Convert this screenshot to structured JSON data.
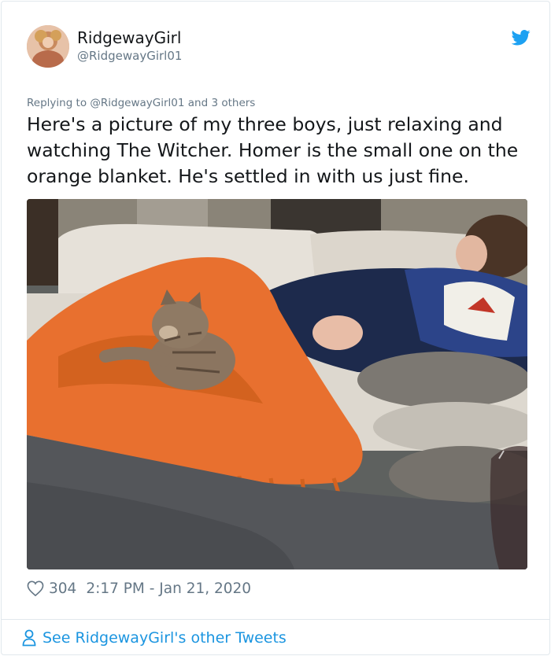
{
  "user": {
    "display_name": "RidgewayGirl",
    "handle": "@RidgewayGirl01"
  },
  "tweet": {
    "replying_to": "Replying to @RidgewayGirl01 and 3 others",
    "text": "Here's a picture of my three boys, just relaxing and watching The Witcher. Homer is the small one on the orange blanket. He's settled in with us just fine.",
    "likes": "304",
    "timestamp": "2:17 PM - Jan 21, 2020"
  },
  "footer": {
    "see_more": "See RidgewayGirl's other Tweets"
  },
  "colors": {
    "twitter_blue": "#1da1f2",
    "link_blue": "#1b95e0",
    "muted_gray": "#657786",
    "blanket_orange": "#e8702f"
  },
  "icons": [
    "twitter-bird-icon",
    "heart-icon",
    "person-icon"
  ]
}
